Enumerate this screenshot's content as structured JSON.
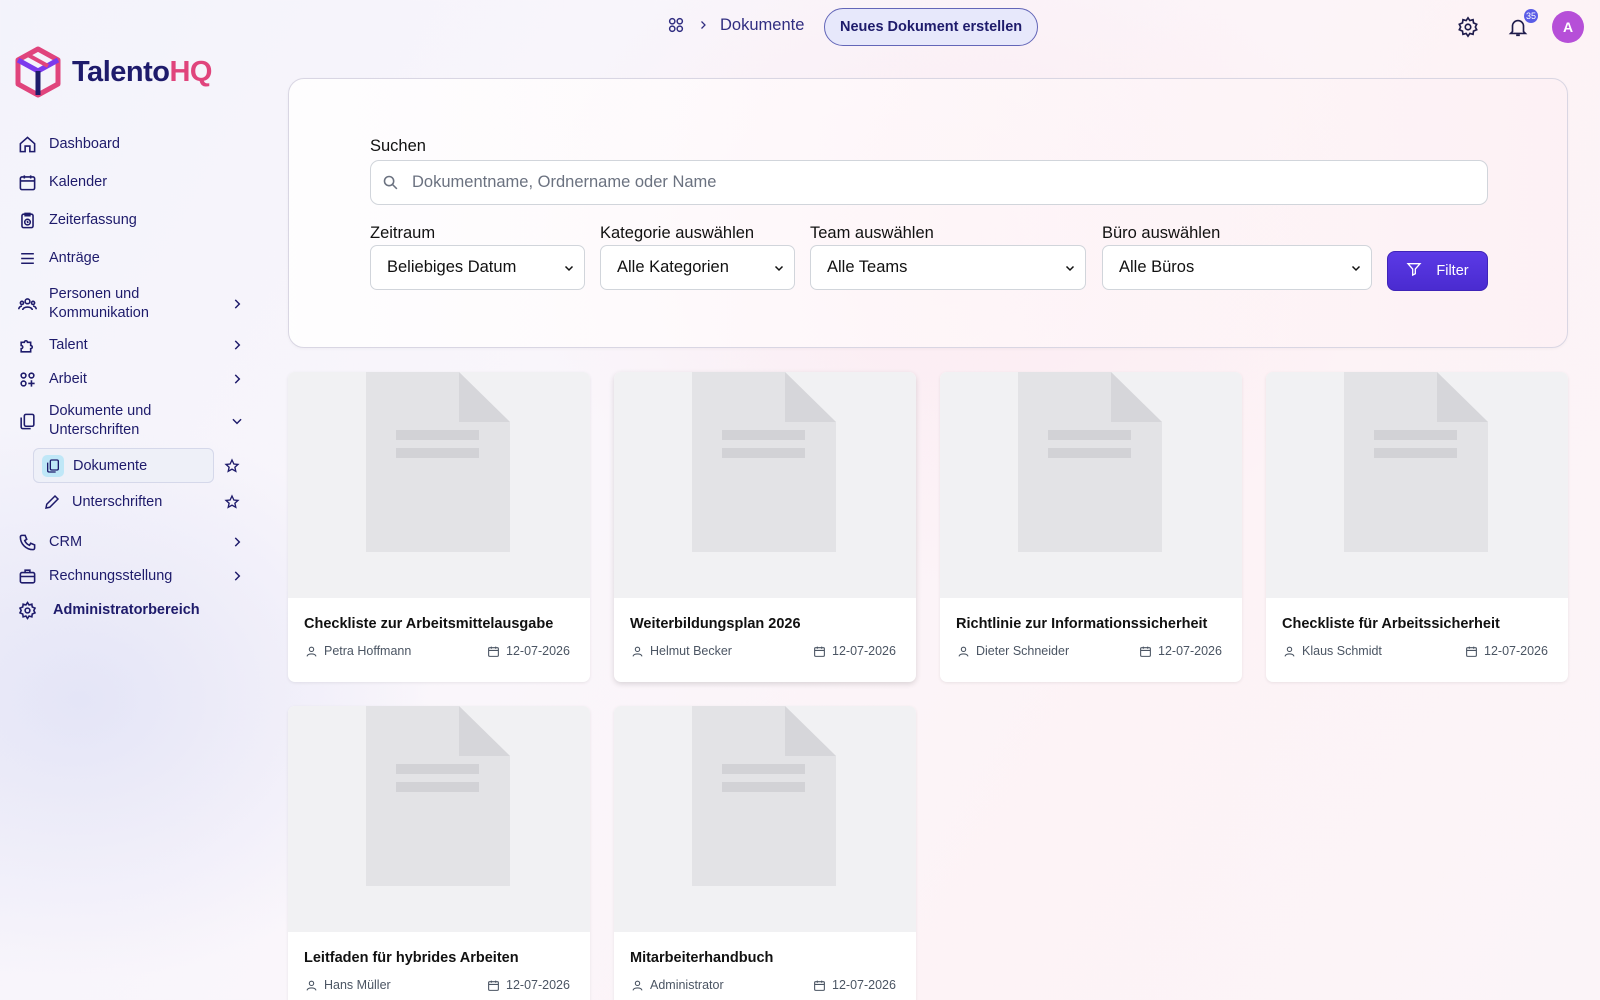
{
  "brand": {
    "name_part1": "Talento",
    "name_part2": "HQ",
    "accent": "#e0447c",
    "primary": "#1e1b6b"
  },
  "sidebar": {
    "items": [
      {
        "label": "Dashboard",
        "icon": "home-icon"
      },
      {
        "label": "Kalender",
        "icon": "calendar-icon"
      },
      {
        "label": "Zeiterfassung",
        "icon": "clipboard-clock-icon"
      },
      {
        "label": "Anträge",
        "icon": "list-icon"
      },
      {
        "label": "Personen und Kommunikation",
        "icon": "people-icon"
      },
      {
        "label": "Talent",
        "icon": "puzzle-icon"
      },
      {
        "label": "Arbeit",
        "icon": "apps-icon"
      },
      {
        "label": "Dokumente und Unterschriften",
        "icon": "documents-icon"
      },
      {
        "label": "CRM",
        "icon": "phone-icon"
      },
      {
        "label": "Rechnungsstellung",
        "icon": "briefcase-icon"
      },
      {
        "label": "Administratorbereich",
        "icon": "gear-icon"
      }
    ],
    "subitems": [
      {
        "label": "Dokumente",
        "icon": "documents-icon",
        "active": true
      },
      {
        "label": "Unterschriften",
        "icon": "pen-icon",
        "active": false
      }
    ]
  },
  "header": {
    "breadcrumb": "Dokumente",
    "new_button": "Neues Dokument erstellen",
    "notification_count": "35",
    "avatar_initial": "A"
  },
  "filters": {
    "search_label": "Suchen",
    "search_placeholder": "Dokumentname, Ordnername oder Name",
    "period_label": "Zeitraum",
    "period_value": "Beliebiges Datum",
    "category_label": "Kategorie auswählen",
    "category_value": "Alle Kategorien",
    "team_label": "Team auswählen",
    "team_value": "Alle Teams",
    "office_label": "Büro auswählen",
    "office_value": "Alle Büros",
    "filter_button": "Filter",
    "button_color": "#4f2fd8"
  },
  "documents": [
    {
      "title": "Checkliste zur Arbeitsmittelausgabe",
      "author": "Petra Hoffmann",
      "date": "12-07-2026"
    },
    {
      "title": "Weiterbildungsplan 2026",
      "author": "Helmut Becker",
      "date": "12-07-2026"
    },
    {
      "title": "Richtlinie zur Informationssicherheit",
      "author": "Dieter Schneider",
      "date": "12-07-2026"
    },
    {
      "title": "Checkliste für Arbeitssicherheit",
      "author": "Klaus Schmidt",
      "date": "12-07-2026"
    },
    {
      "title": "Leitfaden für hybrides Arbeiten",
      "author": "Hans Müller",
      "date": "12-07-2026"
    },
    {
      "title": "Mitarbeiterhandbuch",
      "author": "Administrator",
      "date": "12-07-2026"
    }
  ]
}
